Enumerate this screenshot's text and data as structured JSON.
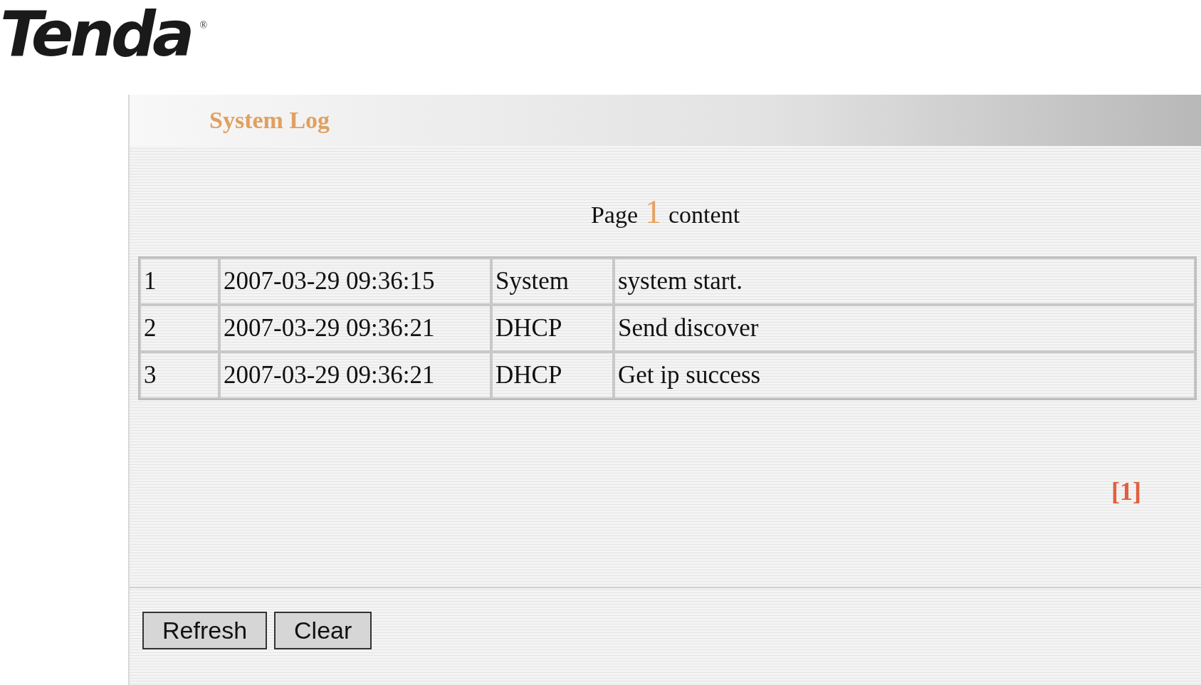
{
  "logo": {
    "text": "Tenda",
    "mark": "®"
  },
  "panel": {
    "title": "System Log"
  },
  "page_caption": {
    "before": "Page",
    "number": "1",
    "after": "content"
  },
  "log_rows": [
    {
      "cells": [
        "1",
        "2007-03-29 09:36:15",
        "System",
        "system start."
      ]
    },
    {
      "cells": [
        "2",
        "2007-03-29 09:36:21",
        "DHCP",
        "Send discover"
      ]
    },
    {
      "cells": [
        "3",
        "2007-03-29 09:36:21",
        "DHCP",
        "Get ip success"
      ]
    }
  ],
  "pager": [
    {
      "label": "[1]",
      "selected": true
    }
  ],
  "buttons": [
    "Refresh",
    "Clear"
  ]
}
